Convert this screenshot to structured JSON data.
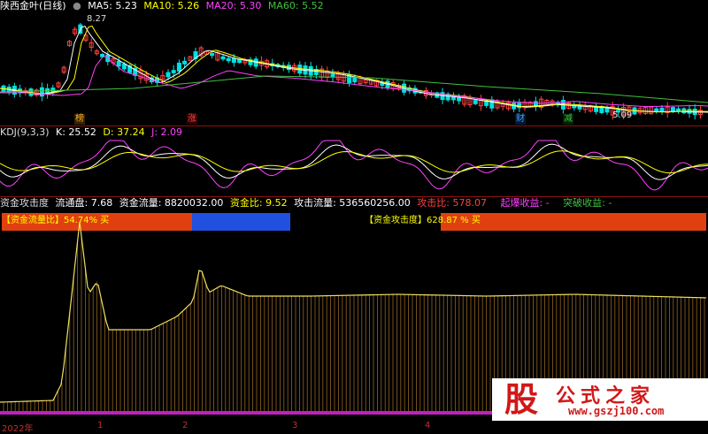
{
  "colors": {
    "up": "#ff4040",
    "down": "#00e0e0",
    "ma5": "#ffffff",
    "ma10": "#ffff00",
    "ma20": "#ff40ff",
    "ma60": "#40c040",
    "k": "#ffffff",
    "d": "#ffff00",
    "j": "#ff40ff"
  },
  "main": {
    "title": "陕西金叶(日线)",
    "ma5_label": "MA5: 5.23",
    "ma10_label": "MA10: 5.26",
    "ma20_label": "MA20: 5.30",
    "ma60_label": "MA60: 5.52",
    "high_label": "8.27",
    "low_label": "5.09",
    "markers": [
      {
        "text": "榜",
        "color": "#ffaa20"
      },
      {
        "text": "涨",
        "color": "#ff4040"
      },
      {
        "text": "财",
        "color": "#40a0ff"
      },
      {
        "text": "减",
        "color": "#40c040"
      }
    ]
  },
  "kdj": {
    "title": "KDJ(9,3,3)",
    "k_label": "K: 25.52",
    "d_label": "D: 37.24",
    "j_label": "J: 2.09"
  },
  "flow": {
    "title": "资金攻击度",
    "ltp_label": "流通盘: 7.68",
    "flow_label": "资金流量: 8820032.00",
    "ratio_label": "资金比: 9.52",
    "attack_flow_label": "攻击流量: 536560256.00",
    "attack_ratio_label": "攻击比: 578.07",
    "burst_label": "起爆收益: -",
    "break_label": "突破收益: -",
    "flow_ratio_legend": "【资金流量比】54.74% 买",
    "attack_legend": "【资金攻击度】628.87 % 买"
  },
  "xaxis": {
    "labels": [
      "2022年",
      "1",
      "2",
      "3",
      "4"
    ]
  },
  "watermark": {
    "glyph": "股",
    "name": "公式之家",
    "url": "www.gszj100.com"
  }
}
